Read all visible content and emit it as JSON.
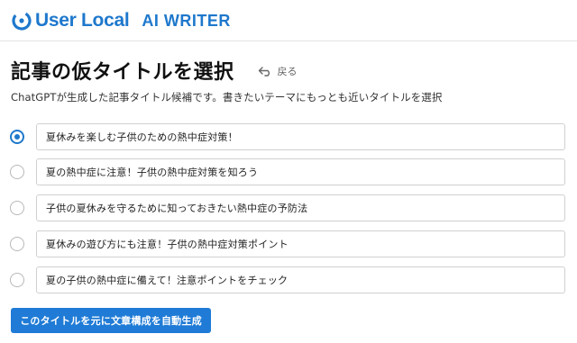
{
  "header": {
    "brand": "User Local",
    "product": "AI WRITER",
    "accent_color": "#1e78cc"
  },
  "page": {
    "title": "記事の仮タイトルを選択",
    "back_label": "戻る",
    "back_icon": "return-arrow-icon",
    "subtitle": "ChatGPTが生成した記事タイトル候補です。書きたいテーマにもっとも近いタイトルを選択"
  },
  "options": [
    {
      "label": "夏休みを楽しむ子供のための熱中症対策！",
      "selected": true
    },
    {
      "label": "夏の熱中症に注意！子供の熱中症対策を知ろう",
      "selected": false
    },
    {
      "label": "子供の夏休みを守るために知っておきたい熱中症の予防法",
      "selected": false
    },
    {
      "label": "夏休みの遊び方にも注意！子供の熱中症対策ポイント",
      "selected": false
    },
    {
      "label": "夏の子供の熱中症に備えて！注意ポイントをチェック",
      "selected": false
    }
  ],
  "submit": {
    "label": "このタイトルを元に文章構成を自動生成",
    "color": "#1f7bd6"
  }
}
